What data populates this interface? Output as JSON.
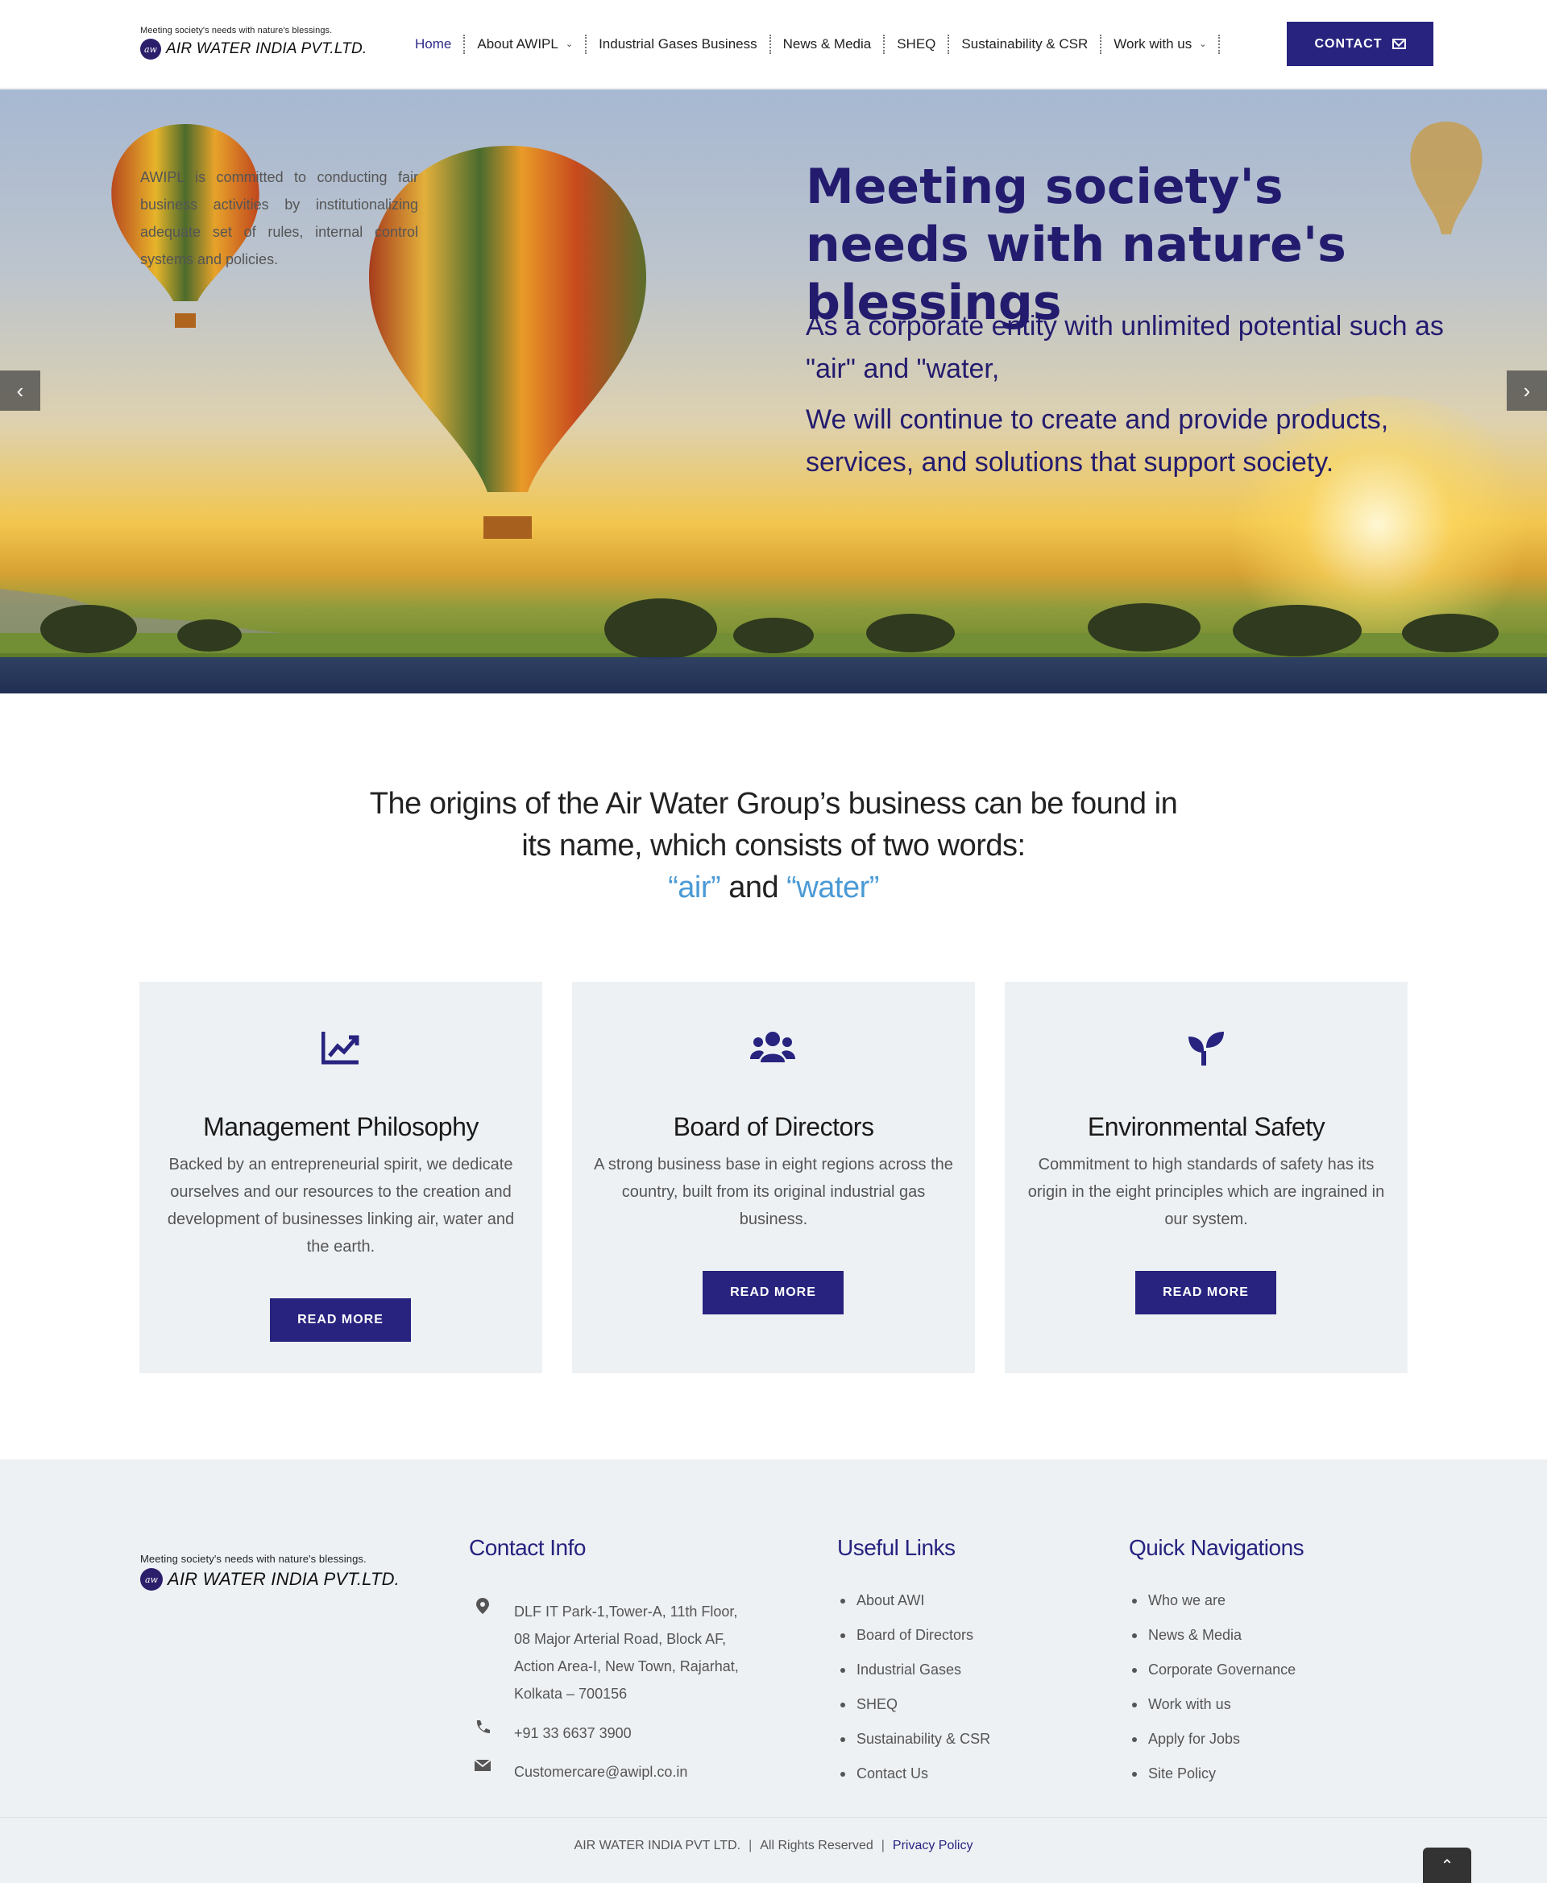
{
  "header": {
    "logo_tagline": "Meeting society's needs with nature's blessings.",
    "logo_name": "AIR WATER INDIA PVT.LTD.",
    "logo_mark": "aw",
    "nav": [
      {
        "label": "Home",
        "active": true
      },
      {
        "label": "About AWIPL",
        "dropdown": true
      },
      {
        "label": "Industrial Gases Business"
      },
      {
        "label": "News & Media"
      },
      {
        "label": "SHEQ"
      },
      {
        "label": "Sustainability & CSR"
      },
      {
        "label": "Work with us",
        "dropdown": true
      }
    ],
    "contact_label": "CONTACT"
  },
  "hero": {
    "title": "Meeting society's needs with nature's blessings",
    "sub1": "As a corporate entity with unlimited potential such as \"air\" and \"water,",
    "sub2": "We will continue to create and provide products, services, and solutions that support society.",
    "prev_icon": "chevron-left-icon",
    "next_icon": "chevron-right-icon"
  },
  "intro": {
    "line1": "The origins of the Air Water Group’s business can be found in",
    "line2": "its name, which consists of two words:",
    "word1": "“air”",
    "and": "and",
    "word2": "“water”"
  },
  "cards": [
    {
      "icon": "chart-line-icon",
      "title": "Management Philosophy",
      "text": "Backed by an entrepreneurial spirit, we dedicate ourselves and our resources to the creation and development of businesses linking air, water and the earth.",
      "button": "READ MORE"
    },
    {
      "icon": "users-icon",
      "title": "Board of Directors",
      "text": "A strong business base in eight regions across the country, built from its original industrial gas business.",
      "button": "READ MORE"
    },
    {
      "icon": "seedling-icon",
      "title": "Environmental Safety",
      "text": "Commitment to high standards of safety has its origin in the eight principles which are ingrained in our system.",
      "button": "READ MORE"
    }
  ],
  "footer": {
    "about": "AWIPL is committed to conducting fair business activities by institutionalizing adequate set of rules, internal control systems and policies.",
    "contact_title": "Contact Info",
    "address_l1": "DLF IT Park-1,Tower-A, 11th Floor,",
    "address_l2": "08 Major Arterial Road, Block AF,",
    "address_l3": "Action Area-I, New Town, Rajarhat,",
    "address_l4": "Kolkata – 700156",
    "phone": "+91 33 6637 3900",
    "email": "Customercare@awipl.co.in",
    "useful_title": "Useful Links",
    "useful_links": [
      "About AWI",
      "Board of Directors",
      "Industrial Gases",
      "SHEQ",
      "Sustainability & CSR",
      "Contact Us"
    ],
    "quick_title": "Quick Navigations",
    "quick_links": [
      "Who we are",
      "News & Media",
      "Corporate Governance",
      "Work with us",
      "Apply for Jobs",
      "Site Policy"
    ],
    "copyright": "AIR WATER INDIA PVT LTD.",
    "rights": "All Rights Reserved",
    "privacy": "Privacy Policy"
  },
  "colors": {
    "brand": "#27237f",
    "accent_blue": "#4a9ad6",
    "panel": "#eef1f4"
  }
}
